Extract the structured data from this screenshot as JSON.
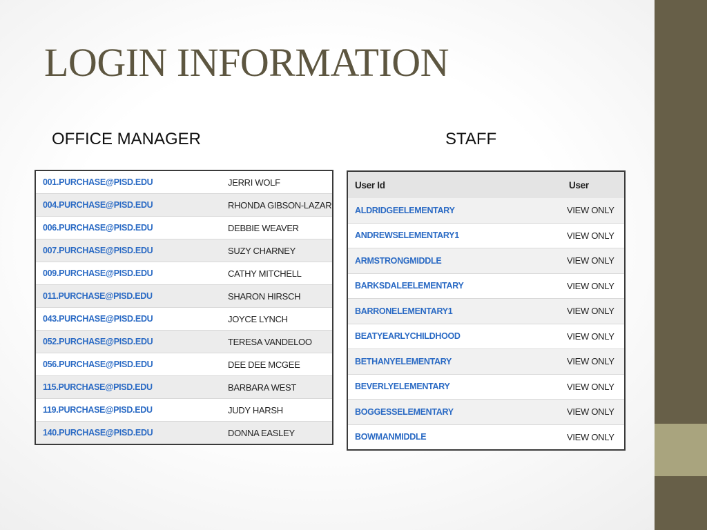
{
  "title": "LOGIN INFORMATION",
  "office_manager": {
    "heading": "OFFICE MANAGER",
    "rows": [
      {
        "email": "001.PURCHASE@PISD.EDU",
        "name": "JERRI WOLF"
      },
      {
        "email": "004.PURCHASE@PISD.EDU",
        "name": "RHONDA GIBSON-LAZARUS"
      },
      {
        "email": "006.PURCHASE@PISD.EDU",
        "name": "DEBBIE WEAVER"
      },
      {
        "email": "007.PURCHASE@PISD.EDU",
        "name": "SUZY CHARNEY"
      },
      {
        "email": "009.PURCHASE@PISD.EDU",
        "name": "CATHY MITCHELL"
      },
      {
        "email": "011.PURCHASE@PISD.EDU",
        "name": "SHARON HIRSCH"
      },
      {
        "email": "043.PURCHASE@PISD.EDU",
        "name": "JOYCE LYNCH"
      },
      {
        "email": "052.PURCHASE@PISD.EDU",
        "name": "TERESA VANDELOO"
      },
      {
        "email": "056.PURCHASE@PISD.EDU",
        "name": "DEE DEE MCGEE"
      },
      {
        "email": "115.PURCHASE@PISD.EDU",
        "name": "BARBARA WEST"
      },
      {
        "email": "119.PURCHASE@PISD.EDU",
        "name": "JUDY HARSH"
      },
      {
        "email": "140.PURCHASE@PISD.EDU",
        "name": "DONNA EASLEY"
      }
    ]
  },
  "staff": {
    "heading": "STAFF",
    "columns": [
      "User Id",
      "User"
    ],
    "rows": [
      {
        "user_id": "ALDRIDGEELEMENTARY",
        "user": "VIEW ONLY"
      },
      {
        "user_id": "ANDREWSELEMENTARY1",
        "user": "VIEW ONLY"
      },
      {
        "user_id": "ARMSTRONGMIDDLE",
        "user": "VIEW ONLY"
      },
      {
        "user_id": "BARKSDALEELEMENTARY",
        "user": "VIEW ONLY"
      },
      {
        "user_id": "BARRONELEMENTARY1",
        "user": "VIEW ONLY"
      },
      {
        "user_id": "BEATYEARLYCHILDHOOD",
        "user": "VIEW ONLY"
      },
      {
        "user_id": "BETHANYELEMENTARY",
        "user": "VIEW ONLY"
      },
      {
        "user_id": "BEVERLYELEMENTARY",
        "user": "VIEW ONLY"
      },
      {
        "user_id": "BOGGESSELEMENTARY",
        "user": "VIEW ONLY"
      },
      {
        "user_id": "BOWMANMIDDLE",
        "user": "VIEW ONLY"
      }
    ]
  },
  "colors": {
    "sidebar": "#675f48",
    "sidebar_accent": "#a9a47e",
    "title": "#5d5640",
    "link": "#2a6ac4"
  }
}
